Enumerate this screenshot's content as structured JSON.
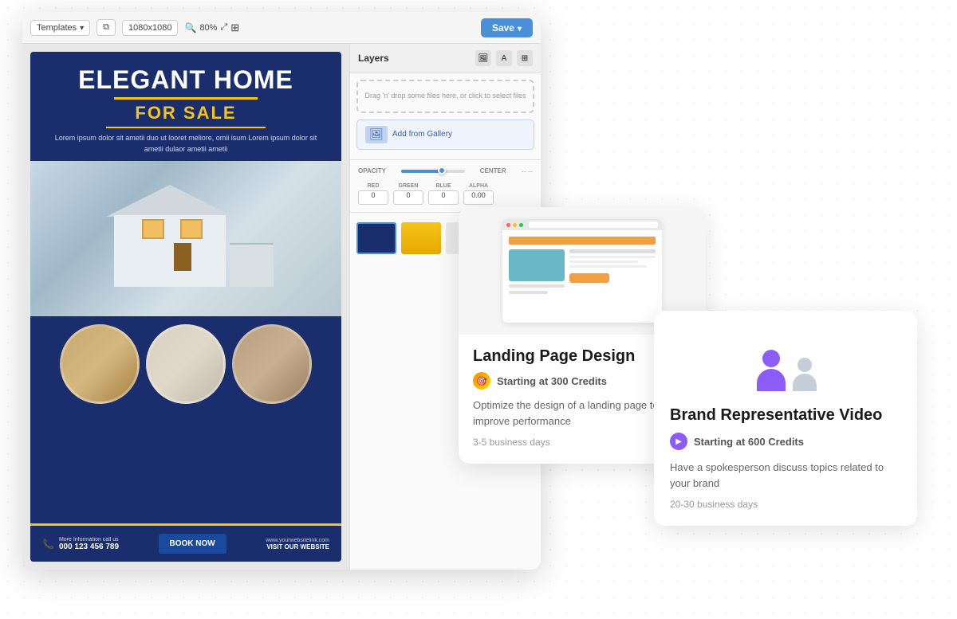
{
  "editor": {
    "toolbar": {
      "templates_label": "Templates",
      "size_label": "1080x1080",
      "zoom_label": "80%",
      "save_label": "Save"
    },
    "layers": {
      "title": "Layers",
      "drop_text": "Drag 'n' drop some files here, or click to select files",
      "gallery_label": "Add from Gallery",
      "opacity_label": "OPACITY",
      "center_label": "CENTER",
      "red_label": "RED",
      "green_label": "GREEN",
      "blue_label": "BLUE",
      "alpha_label": "ALPHA",
      "alpha_value": "0.00",
      "red_value": "0",
      "green_value": "0",
      "blue_value": "0"
    },
    "flyer": {
      "title_line1": "ELEGANT HOME",
      "title_line2": "FOR SALE",
      "description": "Lorem ipsum dolor sit ametii duo ut looret meliore, omii isum\nLorem ipsum dolor sit ametii dulaor ametii ametii",
      "phone_label": "More Information call us",
      "phone_number": "000 123 456 789",
      "book_btn": "BOOK NOW",
      "website": "www.yourwebsitelink.com",
      "website_action": "VISIT OUR WEBSITE"
    }
  },
  "card_landing": {
    "title": "Landing Page Design",
    "credits_text": "Starting at 300 Credits",
    "description": "Optimize the design of a landing page to improve performance",
    "days": "3-5 business days"
  },
  "card_brand": {
    "title": "Brand Representative Video",
    "credits_text": "Starting at 600 Credits",
    "description": "Have a spokesperson discuss topics related to your brand",
    "days": "20-30 business days"
  }
}
